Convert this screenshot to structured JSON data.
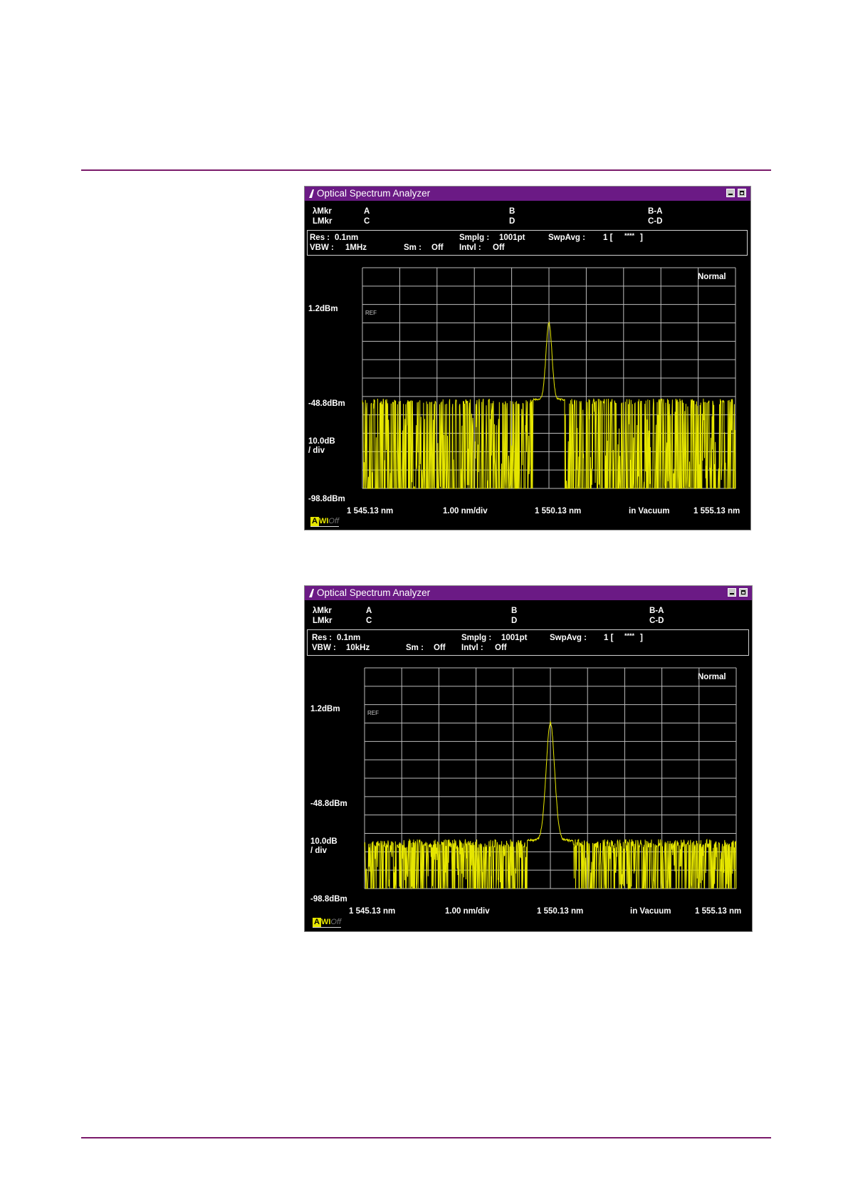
{
  "page": {
    "rule_color": "#7a1a6a"
  },
  "colors": {
    "trace": "#e6e600",
    "grid": "#bdbdbd",
    "titlebar": "#6b1a85",
    "background": "#000000"
  },
  "screens": [
    {
      "window_title": "Optical Spectrum Analyzer",
      "markers": {
        "lambda_label": "λMkr",
        "level_label": "LMkr",
        "a": "A",
        "b": "B",
        "ba": "B-A",
        "c": "C",
        "d": "D",
        "cd": "C-D"
      },
      "params": {
        "res_label": "Res :",
        "res_value": "0.1nm",
        "vbw_label": "VBW :",
        "vbw_value": "1MHz",
        "sm_label": "Sm :",
        "sm_value": "Off",
        "smplg_label": "Smplg :",
        "smplg_value": "1001pt",
        "intvl_label": "Intvl :",
        "intvl_value": "Off",
        "swpavg_label": "SwpAvg :",
        "swpavg_value": "1 [",
        "swpavg_stars": "****",
        "swpavg_close": "]"
      },
      "mode": "Normal",
      "ref_tag": "REF",
      "y_labels": {
        "top": "1.2dBm",
        "mid": "-48.8dBm",
        "scale_1": "10.0dB",
        "scale_2": "/ div",
        "bottom": "-98.8dBm"
      },
      "x_labels": {
        "start": "1 545.13 nm",
        "span": "1.00 nm/div",
        "center": "1 550.13 nm",
        "medium": "in Vacuum",
        "stop": "1 555.13 nm"
      },
      "status": {
        "a": "A",
        "wi": "WI",
        "off": "Off"
      },
      "chart_data": {
        "type": "line",
        "x_range_nm": [
          1545.13,
          1555.13
        ],
        "center_nm": 1550.13,
        "peak": {
          "x_nm": 1550.13,
          "y_dbm": -8.0
        },
        "noise_floor_top_dbm": -50.0,
        "ref_level_dbm": 1.2,
        "scale_db_per_div": 10.0,
        "grid": true,
        "vbw": "1MHz"
      }
    },
    {
      "window_title": "Optical Spectrum Analyzer",
      "markers": {
        "lambda_label": "λMkr",
        "level_label": "LMkr",
        "a": "A",
        "b": "B",
        "ba": "B-A",
        "c": "C",
        "d": "D",
        "cd": "C-D"
      },
      "params": {
        "res_label": "Res :",
        "res_value": "0.1nm",
        "vbw_label": "VBW :",
        "vbw_value": "10kHz",
        "sm_label": "Sm :",
        "sm_value": "Off",
        "smplg_label": "Smplg :",
        "smplg_value": "1001pt",
        "intvl_label": "Intvl :",
        "intvl_value": "Off",
        "swpavg_label": "SwpAvg :",
        "swpavg_value": "1 [",
        "swpavg_stars": "****",
        "swpavg_close": "]"
      },
      "mode": "Normal",
      "ref_tag": "REF",
      "y_labels": {
        "top": "1.2dBm",
        "mid": "-48.8dBm",
        "scale_1": "10.0dB",
        "scale_2": "/ div",
        "bottom": "-98.8dBm"
      },
      "x_labels": {
        "start": "1 545.13 nm",
        "span": "1.00 nm/div",
        "center": "1 550.13 nm",
        "medium": "in Vacuum",
        "stop": "1 555.13 nm"
      },
      "status": {
        "a": "A",
        "wi": "WI",
        "off": "Off"
      },
      "chart_data": {
        "type": "line",
        "x_range_nm": [
          1545.13,
          1555.13
        ],
        "center_nm": 1550.13,
        "peak": {
          "x_nm": 1550.13,
          "y_dbm": -8.0
        },
        "noise_floor_top_dbm": -72.0,
        "ref_level_dbm": 1.2,
        "scale_db_per_div": 10.0,
        "grid": true,
        "vbw": "10kHz"
      }
    }
  ]
}
